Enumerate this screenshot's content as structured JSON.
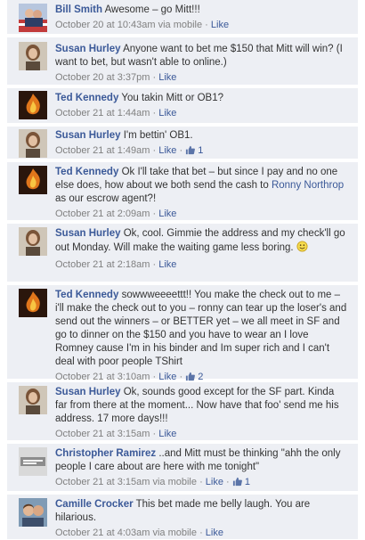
{
  "comments": [
    {
      "author": "Bill Smith",
      "avatar_icon": "profile-photo-flag",
      "text_before": "Awesome – go Mitt!!!",
      "time": "October 20 at 10:43am",
      "via": "via mobile",
      "like": "Like"
    },
    {
      "author": "Susan Hurley",
      "avatar_icon": "profile-photo-woman",
      "text_before": "Anyone want to bet me $150 that Mitt will win? (I want to bet, but wasn't able to online.)",
      "time": "October 20 at 3:37pm",
      "like": "Like"
    },
    {
      "author": "Ted Kennedy",
      "avatar_icon": "profile-photo-fire",
      "text_before": "You takin Mitt or OB1?",
      "time": "October 21 at 1:44am",
      "like": "Like"
    },
    {
      "author": "Susan Hurley",
      "avatar_icon": "profile-photo-woman",
      "text_before": "I'm bettin' OB1.",
      "time": "October 21 at 1:49am",
      "like": "Like",
      "like_count": "1"
    },
    {
      "author": "Ted Kennedy",
      "avatar_icon": "profile-photo-fire",
      "text_before": "Ok I'll take that bet – but since I pay and no one else does, how about we both send the cash to",
      "mention": "Ronny Northrop",
      "text_after": "as our escrow agent?!",
      "time": "October 21 at 2:09am",
      "like": "Like"
    },
    {
      "author": "Susan Hurley",
      "avatar_icon": "profile-photo-woman",
      "text_before": "Ok, cool. Gimmie the address and my check'll go out Monday. Will make the waiting game less boring.",
      "emoticon": "smiley-icon",
      "time": "October 21 at 2:18am",
      "like": "Like"
    },
    {
      "author": "Ted Kennedy",
      "avatar_icon": "profile-photo-fire",
      "text_before": "sowwweeeettt!! You make the check out to me – i'll make the check out to you – ronny can tear up the loser's and send out the winners – or BETTER yet – we all meet in SF and go to dinner on the $150 and you have to wear an I love Romney cause I'm in his binder and Im super rich and I can't deal with poor people TShirt",
      "time": "October 21 at 3:10am",
      "like": "Like",
      "like_count": "2"
    },
    {
      "author": "Susan Hurley",
      "avatar_icon": "profile-photo-woman",
      "text_before": "Ok, sounds good except for the SF part. Kinda far from there at the moment... Now have that foo' send me his address. 17 more days!!!",
      "time": "October 21 at 3:15am",
      "like": "Like"
    },
    {
      "author": "Christopher Ramirez",
      "avatar_icon": "profile-photo-text",
      "text_before": "..and Mitt must be thinking \"ahh the only people I care about are here with me tonight\"",
      "time": "October 21 at 3:15am",
      "via": "via mobile",
      "like": "Like",
      "like_count": "1"
    },
    {
      "author": "Camille Crocker",
      "avatar_icon": "profile-photo-couple",
      "text_before": "This bet made me belly laugh. You are hilarious.",
      "time": "October 21 at 4:03am",
      "via": "via mobile",
      "like": "Like"
    }
  ]
}
